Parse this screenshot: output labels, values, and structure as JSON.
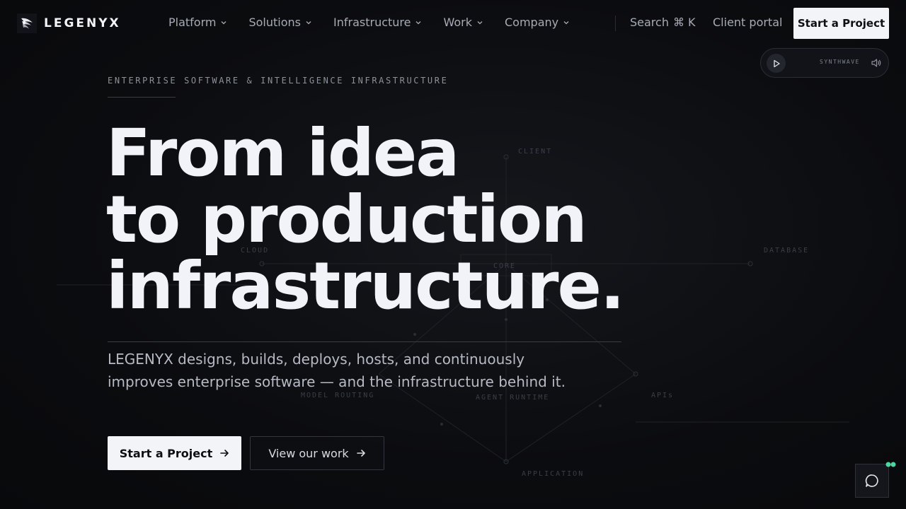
{
  "brand": {
    "name": "LEGENYX",
    "logo_icon": "wing-logo-icon"
  },
  "nav": {
    "items": [
      {
        "label": "Platform"
      },
      {
        "label": "Solutions"
      },
      {
        "label": "Infrastructure"
      },
      {
        "label": "Work"
      },
      {
        "label": "Company"
      }
    ],
    "search_label": "Search",
    "search_shortcut": "⌘ K",
    "portal_label": "Client portal",
    "cta_label": "Start a Project"
  },
  "player": {
    "track_label": "SYNTHWAVE"
  },
  "diagram": {
    "labels": {
      "client": "CLIENT",
      "cloud": "CLOUD",
      "core": "CORE",
      "database": "DATABASE",
      "model_routing": "MODEL ROUTING",
      "agent_runtime": "AGENT RUNTIME",
      "apis": "APIs",
      "application": "APPLICATION"
    }
  },
  "hero": {
    "eyebrow": "ENTERPRISE SOFTWARE & INTELLIGENCE INFRASTRUCTURE",
    "headline": [
      "From idea",
      "to production",
      "infrastructure."
    ],
    "sub": [
      "LEGENYX designs, builds, deploys, hosts, and continuously",
      "improves enterprise software — and the infrastructure behind it."
    ],
    "primary_cta": "Start a Project",
    "secondary_cta": "View our work"
  },
  "colors": {
    "accent": "#f3f4f8",
    "status_dot": "#4fd6a0",
    "background": "#0b0c0f"
  }
}
